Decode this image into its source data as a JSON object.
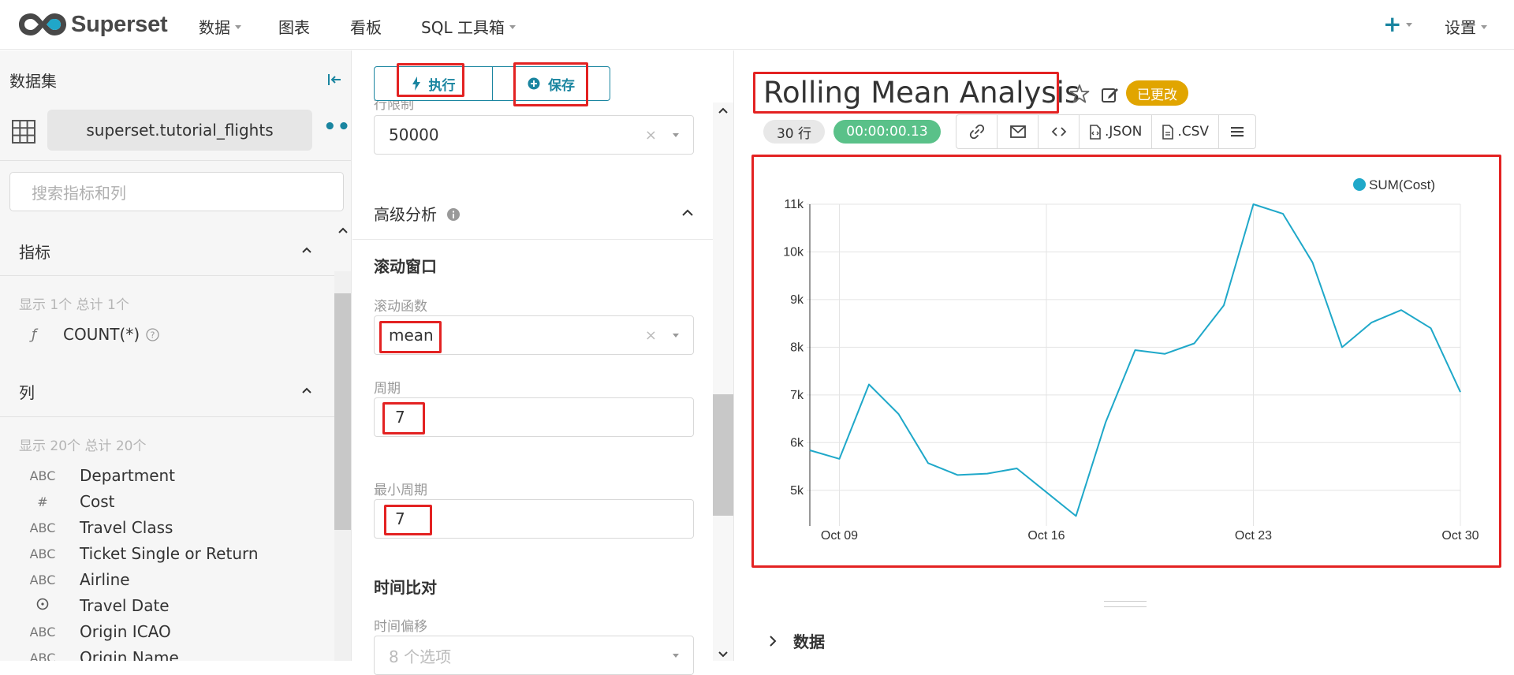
{
  "nav": {
    "brand": "Superset",
    "items": [
      {
        "label": "数据",
        "dropdown": true
      },
      {
        "label": "图表",
        "dropdown": false
      },
      {
        "label": "看板",
        "dropdown": false
      },
      {
        "label": "SQL 工具箱",
        "dropdown": true
      }
    ],
    "plus": "+",
    "settings": "设置"
  },
  "dataset_panel": {
    "title": "数据集",
    "dataset_name": "superset.tutorial_flights",
    "search_placeholder": "搜索指标和列",
    "metrics": {
      "header": "指标",
      "summary": "显示 1个 总计 1个",
      "items": [
        {
          "type": "ƒ",
          "name": "COUNT(*)"
        }
      ]
    },
    "columns": {
      "header": "列",
      "summary": "显示 20个 总计 20个",
      "items": [
        {
          "type": "ABC",
          "name": "Department"
        },
        {
          "type": "#",
          "name": "Cost"
        },
        {
          "type": "ABC",
          "name": "Travel Class"
        },
        {
          "type": "ABC",
          "name": "Ticket Single or Return"
        },
        {
          "type": "ABC",
          "name": "Airline"
        },
        {
          "type": "clock",
          "name": "Travel Date"
        },
        {
          "type": "ABC",
          "name": "Origin ICAO"
        },
        {
          "type": "ABC",
          "name": "Origin Name"
        }
      ]
    }
  },
  "controls": {
    "run_label": "执行",
    "save_label": "保存",
    "row_limit_label": "行限制",
    "row_limit_value": "50000",
    "advanced_title": "高级分析",
    "rolling": {
      "title": "滚动窗口",
      "func_label": "滚动函数",
      "func_value": "mean",
      "period_label": "周期",
      "period_value": "7",
      "min_period_label": "最小周期",
      "min_period_value": "7"
    },
    "time_compare": {
      "title": "时间比对",
      "shift_label": "时间偏移",
      "shift_placeholder": "8 个选项"
    }
  },
  "chart_header": {
    "title": "Rolling Mean Analysis",
    "changed_badge": "已更改",
    "rows": "30 行",
    "duration": "00:00:00.13",
    "toolbar": {
      "json": ".JSON",
      "csv": ".CSV"
    }
  },
  "data_section": {
    "label": "数据"
  },
  "colors": {
    "accent": "#1a85a0",
    "series": "#1fa8c9",
    "changed": "#e1a500",
    "success": "#5ac189",
    "highlight": "#e32222"
  },
  "chart_data": {
    "type": "line",
    "title": "",
    "xlabel": "",
    "ylabel": "",
    "x_ticks": [
      "Oct 09",
      "Oct 16",
      "Oct 23",
      "Oct 30"
    ],
    "y_ticks": [
      "5k",
      "6k",
      "7k",
      "8k",
      "9k",
      "10k",
      "11k"
    ],
    "ylim": [
      4500,
      11000
    ],
    "legend": "top-right",
    "series": [
      {
        "name": "SUM(Cost)",
        "x": [
          "Oct 08",
          "Oct 09",
          "Oct 10",
          "Oct 11",
          "Oct 12",
          "Oct 13",
          "Oct 14",
          "Oct 15",
          "Oct 16",
          "Oct 17",
          "Oct 18",
          "Oct 19",
          "Oct 20",
          "Oct 21",
          "Oct 22",
          "Oct 23",
          "Oct 24",
          "Oct 25",
          "Oct 26",
          "Oct 27",
          "Oct 28",
          "Oct 29",
          "Oct 30"
        ],
        "values": [
          5840,
          5660,
          7220,
          6600,
          5570,
          5320,
          5350,
          5460,
          4960,
          4460,
          6420,
          7940,
          7860,
          8080,
          8880,
          11000,
          10800,
          9780,
          8000,
          8520,
          8780,
          8400,
          7060
        ]
      }
    ]
  }
}
